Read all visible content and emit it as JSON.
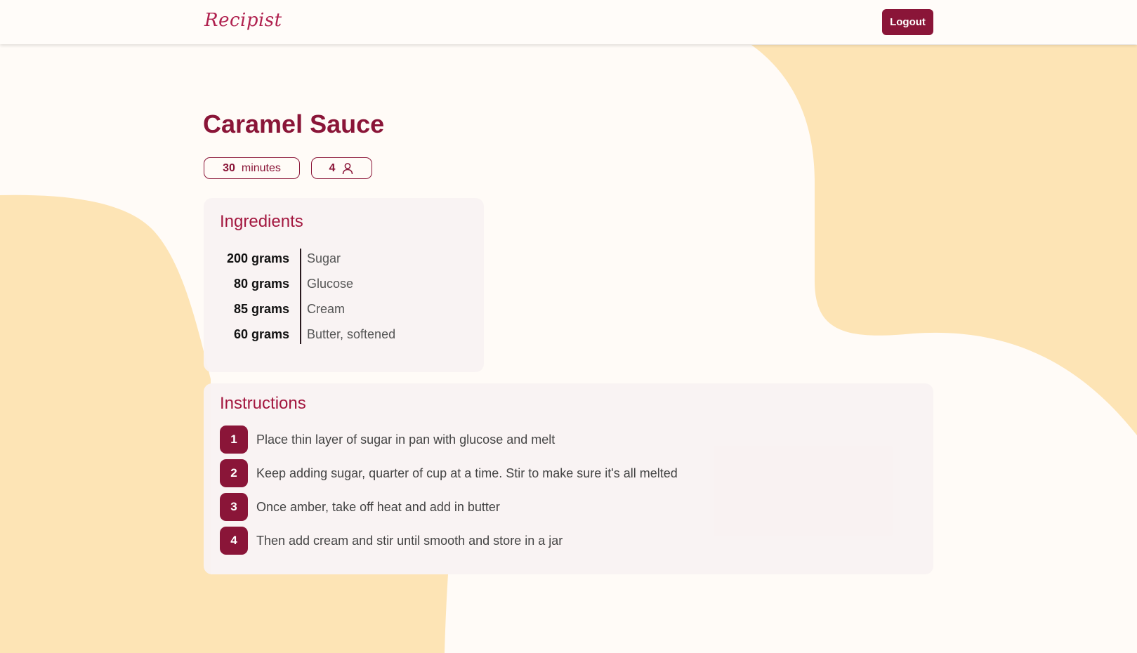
{
  "app": {
    "logo": "Recipist",
    "logout_label": "Logout"
  },
  "recipe": {
    "title": "Caramel Sauce",
    "time_value": "30",
    "time_unit": "minutes",
    "servings": "4"
  },
  "ingredients": {
    "heading": "Ingredients",
    "items": [
      {
        "qty": "200 grams",
        "name": "Sugar"
      },
      {
        "qty": "80 grams",
        "name": "Glucose"
      },
      {
        "qty": "85 grams",
        "name": "Cream"
      },
      {
        "qty": "60 grams",
        "name": "Butter, softened"
      }
    ]
  },
  "instructions": {
    "heading": "Instructions",
    "steps": [
      {
        "num": "1",
        "text": "Place thin layer of sugar in pan with glucose and melt"
      },
      {
        "num": "2",
        "text": "Keep adding sugar, quarter of cup at a time. Stir to make sure it's all melted"
      },
      {
        "num": "3",
        "text": "Once amber, take off heat and add in butter"
      },
      {
        "num": "4",
        "text": "Then add cream and stir until smooth and store in a jar"
      }
    ]
  },
  "icons": {
    "servings": "person-icon"
  },
  "colors": {
    "accent": "#8a1538",
    "heading": "#a3173f",
    "background": "#fffbf7",
    "blob": "#fde4b5",
    "card": "#f9f2f2"
  }
}
